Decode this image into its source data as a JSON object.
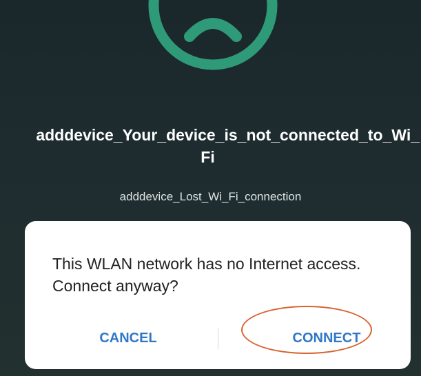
{
  "screen": {
    "icon": "sad-face-icon",
    "title_line1": "adddevice_Your_device_is_not_connected_to_Wi_",
    "title_line2": "Fi",
    "subtitle": "adddevice_Lost_Wi_Fi_connection"
  },
  "dialog": {
    "message": "This WLAN network has no Internet access. Connect anyway?",
    "cancel_label": "CANCEL",
    "connect_label": "CONNECT"
  },
  "colors": {
    "background": "#1d2b2f",
    "icon": "#2f9a78",
    "button_text": "#2f77c8",
    "annotation": "#d8622f"
  }
}
